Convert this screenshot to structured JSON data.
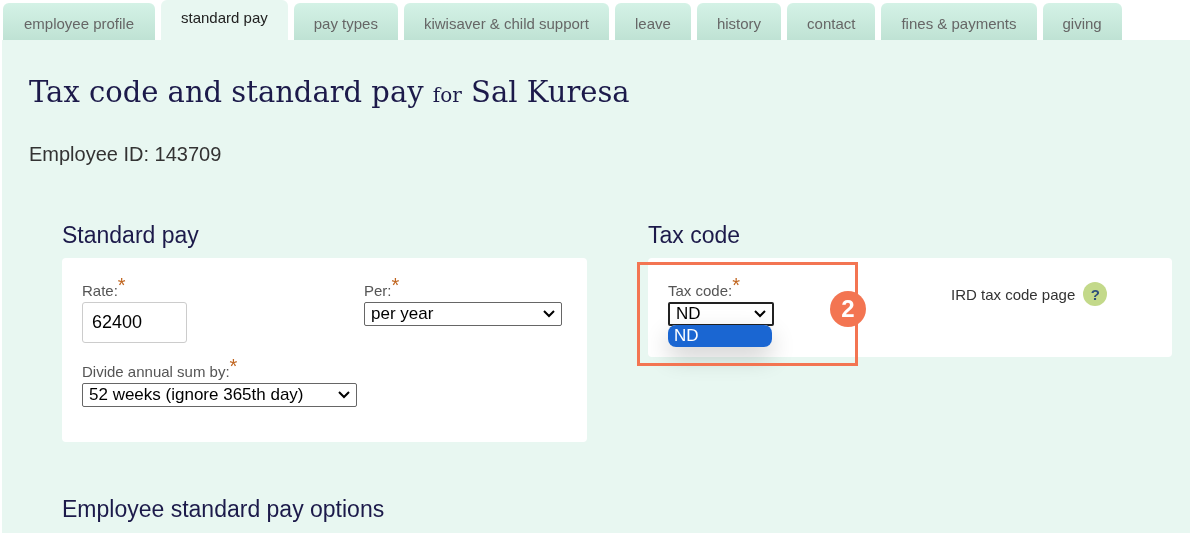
{
  "tabs": [
    {
      "label": "employee profile",
      "selected": false
    },
    {
      "label": "standard pay",
      "selected": true
    },
    {
      "label": "pay types",
      "selected": false
    },
    {
      "label": "kiwisaver & child support",
      "selected": false
    },
    {
      "label": "leave",
      "selected": false
    },
    {
      "label": "history",
      "selected": false
    },
    {
      "label": "contact",
      "selected": false
    },
    {
      "label": "fines & payments",
      "selected": false
    },
    {
      "label": "giving",
      "selected": false
    }
  ],
  "title": {
    "main": "Tax code and standard pay",
    "joiner": "for",
    "name": "Sal Kuresa"
  },
  "employee_id": "Employee ID: 143709",
  "standard_pay": {
    "heading": "Standard pay",
    "rate": {
      "label": "Rate:",
      "required_mark": "*",
      "value": "62400"
    },
    "per": {
      "label": "Per:",
      "required_mark": "*",
      "value": "per year"
    },
    "divide": {
      "label": "Divide annual sum by:",
      "required_mark": "*",
      "value": "52 weeks (ignore 365th day)"
    }
  },
  "tax_code": {
    "heading": "Tax code",
    "field": {
      "label": "Tax code:",
      "required_mark": "*",
      "value": "ND",
      "expanded": true,
      "options": [
        {
          "label": "ND",
          "selected": true
        }
      ]
    },
    "link": "IRD tax code page",
    "help": "?"
  },
  "annotation": {
    "number": "2"
  },
  "options_heading": "Employee standard pay options"
}
